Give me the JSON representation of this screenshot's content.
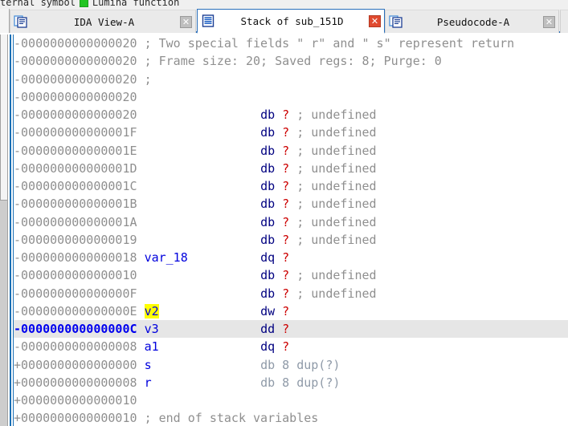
{
  "legend_strip": {
    "text_fragment": "ternal symbol",
    "swatch_color": "#22c522",
    "swatch_label": "Lumina function"
  },
  "tabs": [
    {
      "label": "IDA View-A",
      "icon": "document-icon",
      "close_icon": "close-icon",
      "active": false,
      "close_style": "grey"
    },
    {
      "label": "Stack of sub_151D",
      "icon": "stack-frame-icon",
      "close_icon": "close-icon",
      "active": true,
      "close_style": "red"
    },
    {
      "label": "Pseudocode-A",
      "icon": "document-icon",
      "close_icon": "close-icon",
      "active": false,
      "close_style": "grey"
    }
  ],
  "colors": {
    "address": "#8f8f8f",
    "current_address": "#0000ee",
    "variable_name": "#0000dd",
    "keyword": "#000080",
    "question_mark": "#cc0000",
    "comment": "#8f8f8f",
    "highlight_background": "#ffff00",
    "current_line_background": "#e6e6e6",
    "tab_underline": "#2a6fbb"
  },
  "stack_view": {
    "title": "Stack of sub_151D",
    "rows": [
      {
        "addr": "-0000000000000020",
        "name": "",
        "kw": "",
        "q": "",
        "comment": "; Two special fields \" r\" and \" s\" represent return",
        "style": "comment-line"
      },
      {
        "addr": "-0000000000000020",
        "name": "",
        "kw": "",
        "q": "",
        "comment": "; Frame size: 20; Saved regs: 8; Purge: 0",
        "style": "comment-line"
      },
      {
        "addr": "-0000000000000020",
        "name": "",
        "kw": "",
        "q": "",
        "comment": ";",
        "style": "comment-line"
      },
      {
        "addr": "-0000000000000020",
        "name": "",
        "kw": "",
        "q": "",
        "comment": "",
        "style": "blank"
      },
      {
        "addr": "-0000000000000020",
        "name": "",
        "kw": "db",
        "q": "?",
        "comment": "; undefined",
        "style": "data"
      },
      {
        "addr": "-000000000000001F",
        "name": "",
        "kw": "db",
        "q": "?",
        "comment": "; undefined",
        "style": "data"
      },
      {
        "addr": "-000000000000001E",
        "name": "",
        "kw": "db",
        "q": "?",
        "comment": "; undefined",
        "style": "data"
      },
      {
        "addr": "-000000000000001D",
        "name": "",
        "kw": "db",
        "q": "?",
        "comment": "; undefined",
        "style": "data"
      },
      {
        "addr": "-000000000000001C",
        "name": "",
        "kw": "db",
        "q": "?",
        "comment": "; undefined",
        "style": "data"
      },
      {
        "addr": "-000000000000001B",
        "name": "",
        "kw": "db",
        "q": "?",
        "comment": "; undefined",
        "style": "data"
      },
      {
        "addr": "-000000000000001A",
        "name": "",
        "kw": "db",
        "q": "?",
        "comment": "; undefined",
        "style": "data"
      },
      {
        "addr": "-0000000000000019",
        "name": "",
        "kw": "db",
        "q": "?",
        "comment": "; undefined",
        "style": "data"
      },
      {
        "addr": "-0000000000000018",
        "name": "var_18",
        "kw": "dq",
        "q": "?",
        "comment": "",
        "style": "data"
      },
      {
        "addr": "-0000000000000010",
        "name": "",
        "kw": "db",
        "q": "?",
        "comment": "; undefined",
        "style": "data"
      },
      {
        "addr": "-000000000000000F",
        "name": "",
        "kw": "db",
        "q": "?",
        "comment": "; undefined",
        "style": "data"
      },
      {
        "addr": "-000000000000000E",
        "name": "v2",
        "kw": "dw",
        "q": "?",
        "comment": "",
        "style": "data",
        "highlight": true
      },
      {
        "addr": "-000000000000000C",
        "name": "v3",
        "kw": "dd",
        "q": "?",
        "comment": "",
        "style": "data",
        "current": true
      },
      {
        "addr": "-0000000000000008",
        "name": "a1",
        "kw": "dq",
        "q": "?",
        "comment": "",
        "style": "data"
      },
      {
        "addr": "+0000000000000000",
        "name": "s",
        "kw": "db 8 dup(?)",
        "q": "",
        "comment": "",
        "style": "dup"
      },
      {
        "addr": "+0000000000000008",
        "name": "r",
        "kw": "db 8 dup(?)",
        "q": "",
        "comment": "",
        "style": "dup"
      },
      {
        "addr": "+0000000000000010",
        "name": "",
        "kw": "",
        "q": "",
        "comment": "",
        "style": "blank"
      },
      {
        "addr": "+0000000000000010",
        "name": "",
        "kw": "",
        "q": "",
        "comment": "; end of stack variables",
        "style": "comment-line"
      }
    ]
  },
  "scrollbar": {
    "orientation": "vertical",
    "thumb_top_percent": 0,
    "thumb_height_percent": 42
  }
}
